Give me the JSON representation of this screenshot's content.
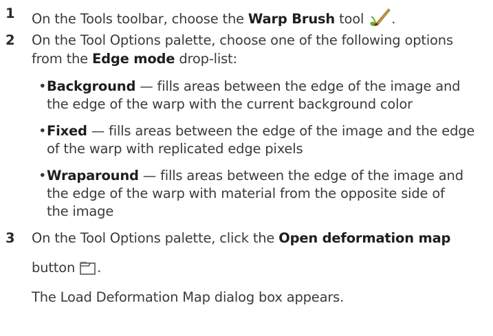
{
  "steps": [
    {
      "number": "1",
      "lines": [
        {
          "pre": "On the Tools toolbar, choose the ",
          "bold": "Warp Brush",
          "post": " tool",
          "icon": "warp-brush-tool-icon",
          "end": "."
        }
      ]
    },
    {
      "number": "2",
      "lines": [
        {
          "text": "On the Tool Options palette, choose one of the following options"
        },
        {
          "pre": "from the ",
          "bold": "Edge mode",
          "post": " drop-list:"
        }
      ],
      "options": [
        {
          "bold": "Background",
          "first": " — fills areas between the edge of the image and",
          "rest": [
            "the edge of the warp with the current background color"
          ]
        },
        {
          "bold": "Fixed",
          "first": " — fills areas between the edge of the image and the edge",
          "rest": [
            "of the warp with replicated edge pixels"
          ]
        },
        {
          "bold": "Wraparound",
          "first": " — fills areas between the edge of the image and",
          "rest": [
            "the edge of the warp with material from the opposite side of",
            "the image"
          ]
        }
      ]
    },
    {
      "number": "3",
      "lines": [
        {
          "pre": "On the Tool Options palette, click the ",
          "bold": "Open deformation map",
          "post": ""
        },
        {
          "pre": "button ",
          "icon": "folder-open-icon",
          "end": "."
        }
      ],
      "result": "The Load Deformation Map dialog box appears."
    }
  ],
  "bullet_glyph": "•",
  "colors": {
    "text": "#3a3a3a",
    "icon_brush_handle": "#c89a3c",
    "icon_brush_tip": "#6b3b10",
    "icon_green": "#6fae2c"
  }
}
